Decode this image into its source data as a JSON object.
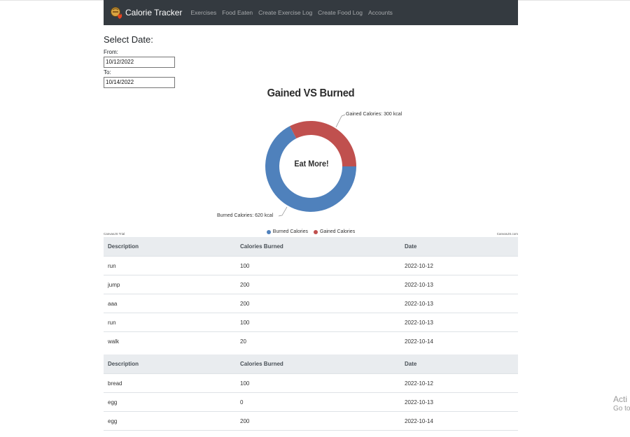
{
  "navbar": {
    "brand": "Calorie Tracker",
    "links": [
      "Exercises",
      "Food Eaten",
      "Create Exercise Log",
      "Create Food Log",
      "Accounts"
    ]
  },
  "date_form": {
    "heading": "Select Date:",
    "from_label": "From:",
    "from_value": "10/12/2022",
    "to_label": "To:",
    "to_value": "10/14/2022"
  },
  "chart_data": {
    "type": "pie",
    "title": "Gained VS Burned",
    "center_text": "Eat More!",
    "series": [
      {
        "name": "Burned Calories",
        "value": 620,
        "label": "Burned Calories: 620 kcal",
        "color": "#4f81bc"
      },
      {
        "name": "Gained Calories",
        "value": 300,
        "label": "Gained Calories: 300 kcal",
        "color": "#c0504e"
      }
    ],
    "legend_position": "bottom",
    "credit_left": "CanvasJS Trial",
    "credit_right": "CanvasJS.com"
  },
  "exercise_table": {
    "headers": [
      "Description",
      "Calories Burned",
      "Date"
    ],
    "rows": [
      [
        "run",
        "100",
        "2022-10-12"
      ],
      [
        "jump",
        "200",
        "2022-10-13"
      ],
      [
        "aaa",
        "200",
        "2022-10-13"
      ],
      [
        "run",
        "100",
        "2022-10-13"
      ],
      [
        "walk",
        "20",
        "2022-10-14"
      ]
    ]
  },
  "food_table": {
    "headers": [
      "Description",
      "Calories Burned",
      "Date"
    ],
    "rows": [
      [
        "bread",
        "100",
        "2022-10-12"
      ],
      [
        "egg",
        "0",
        "2022-10-13"
      ],
      [
        "egg",
        "200",
        "2022-10-14"
      ]
    ]
  },
  "watermark": {
    "line1": "Acti",
    "line2": "Go to"
  }
}
